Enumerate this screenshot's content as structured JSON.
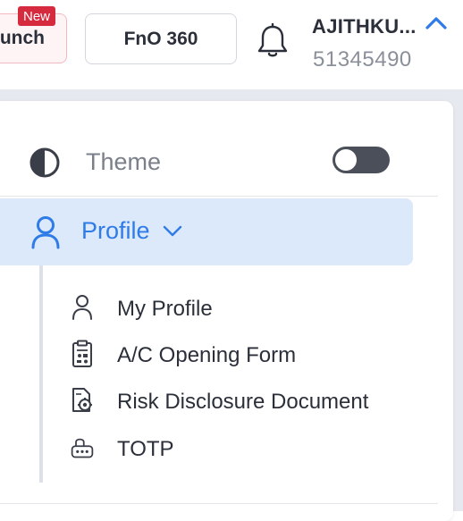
{
  "header": {
    "launch_label": "unch",
    "new_badge": "New",
    "fno_label": "FnO 360",
    "user_name": "AJITHKU...",
    "user_id": "51345490"
  },
  "menu": {
    "theme_label": "Theme",
    "theme_toggle_on": false,
    "profile_label": "Profile",
    "profile_items": [
      {
        "label": "My Profile",
        "icon": "person-icon"
      },
      {
        "label": "A/C Opening Form",
        "icon": "clipboard-form-icon"
      },
      {
        "label": "Risk Disclosure Document",
        "icon": "document-gear-icon"
      },
      {
        "label": "TOTP",
        "icon": "lock-key-icon"
      }
    ]
  },
  "colors": {
    "accent": "#2f7be8",
    "active_bg": "#dce9fb",
    "badge": "#d62b3f",
    "toggle": "#4b4f5a"
  }
}
